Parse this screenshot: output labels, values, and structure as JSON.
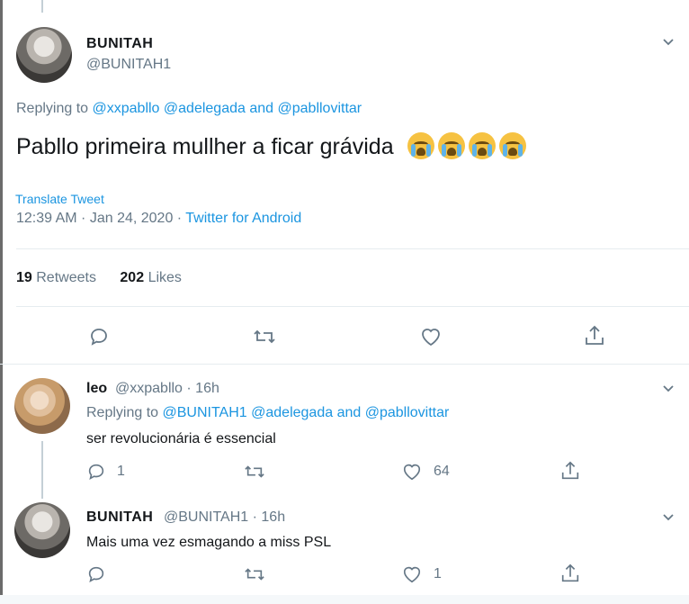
{
  "main_tweet": {
    "name": "BUNITAH",
    "handle": "@BUNITAH1",
    "replying_prefix": "Replying to",
    "replying_mentions": [
      "@xxpabllo",
      "@adelegada"
    ],
    "replying_and": "and",
    "replying_last": "@pabllovittar",
    "text": "Pabllo primeira mullher a ficar grávida",
    "emoji_count": 4,
    "translate": "Translate Tweet",
    "timestamp": "12:39 AM · Jan 24, 2020 ·",
    "source": "Twitter for Android",
    "retweets_count": "19",
    "retweets_label": "Retweets",
    "likes_count": "202",
    "likes_label": "Likes"
  },
  "reply1": {
    "name": "leo",
    "handle_time": "@xxpabllo · 16h",
    "replying_prefix": "Replying to",
    "replying_mentions": [
      "@BUNITAH1",
      "@adelegada"
    ],
    "replying_and": "and",
    "replying_last": "@pabllovittar",
    "text": "ser revolucionária é essencial",
    "reply_count": "1",
    "like_count": "64"
  },
  "reply2": {
    "name": "BUNITAH",
    "handle_time": "@BUNITAH1 · 16h",
    "text": "Mais uma vez esmagando a miss PSL",
    "like_count": "1"
  },
  "icons": [
    "chevron-down-icon",
    "reply-icon",
    "retweet-icon",
    "like-icon",
    "share-icon",
    "crying-emoji"
  ],
  "colors": {
    "link": "#1b95e0",
    "secondary": "#657786",
    "text": "#14171a",
    "divider": "#e6ecf0"
  }
}
